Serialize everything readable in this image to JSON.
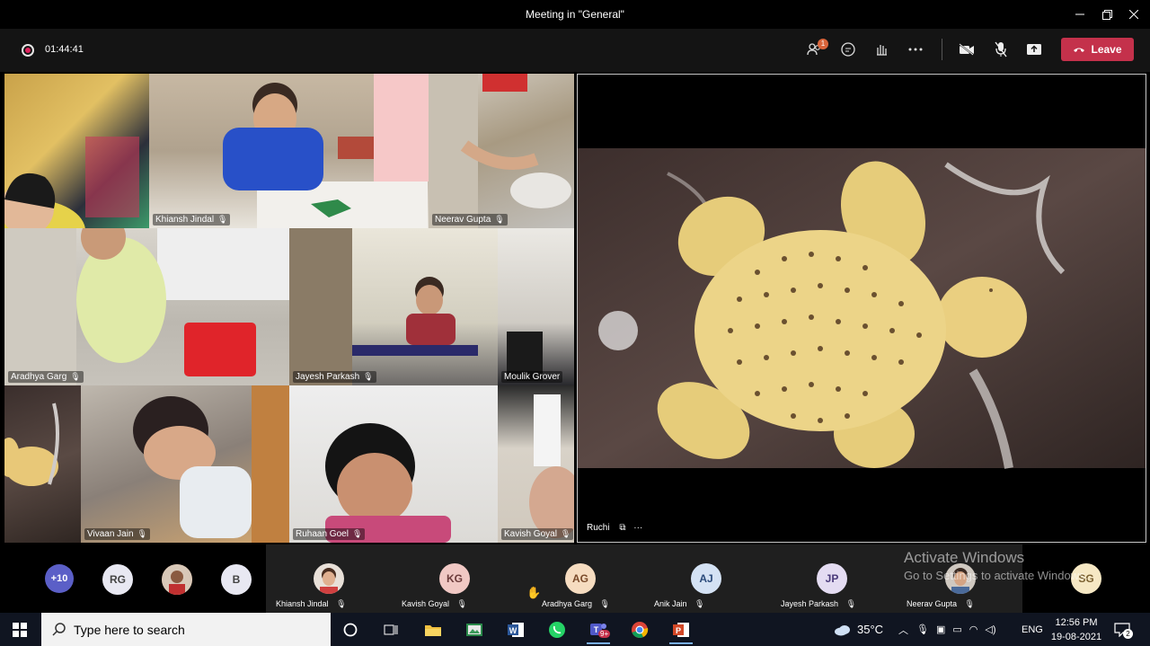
{
  "window": {
    "title": "Meeting in \"General\""
  },
  "toolbar": {
    "timer": "01:44:41",
    "participants_badge": "1",
    "leave_label": "Leave"
  },
  "grid": {
    "tiles": [
      {
        "name": ""
      },
      {
        "name": "Khiansh  Jindal"
      },
      {
        "name": "Neerav  Gupta"
      },
      {
        "name": "Aradhya Garg"
      },
      {
        "name": "Jayesh  Parkash"
      },
      {
        "name": "Moulik  Grover"
      },
      {
        "name": "Vivaan Jain"
      },
      {
        "name": "Ruhaan  Goel"
      },
      {
        "name": "Kavish  Goyal"
      }
    ]
  },
  "featured": {
    "name": "Ruchi",
    "more": "···"
  },
  "strip": {
    "overflow": "+10",
    "avatars": [
      {
        "initials": "RG",
        "color": "#e8e8f2"
      },
      {
        "initials": "B",
        "color": "#e8e8f2"
      }
    ],
    "participants": [
      {
        "name": "Khiansh Jindal",
        "initials": ""
      },
      {
        "name": "Kavish Goyal",
        "initials": "KG"
      },
      {
        "name": "Aradhya Garg",
        "initials": "AG"
      },
      {
        "name": "Anik Jain",
        "initials": "AJ"
      },
      {
        "name": "Jayesh Parkash",
        "initials": "JP"
      },
      {
        "name": "Neerav Gupta",
        "initials": ""
      }
    ],
    "last_initials": "SG",
    "watermark_title": "Activate Windows",
    "watermark_sub": "Go to Settings to activate Windows."
  },
  "taskbar": {
    "search_placeholder": "Type here to search",
    "teams_badge": "9+",
    "temperature": "35°C",
    "language": "ENG",
    "time": "12:56 PM",
    "date": "19-08-2021",
    "notifications": "2"
  },
  "colors": {
    "leave": "#c4314b",
    "accent": "#6264a7"
  }
}
